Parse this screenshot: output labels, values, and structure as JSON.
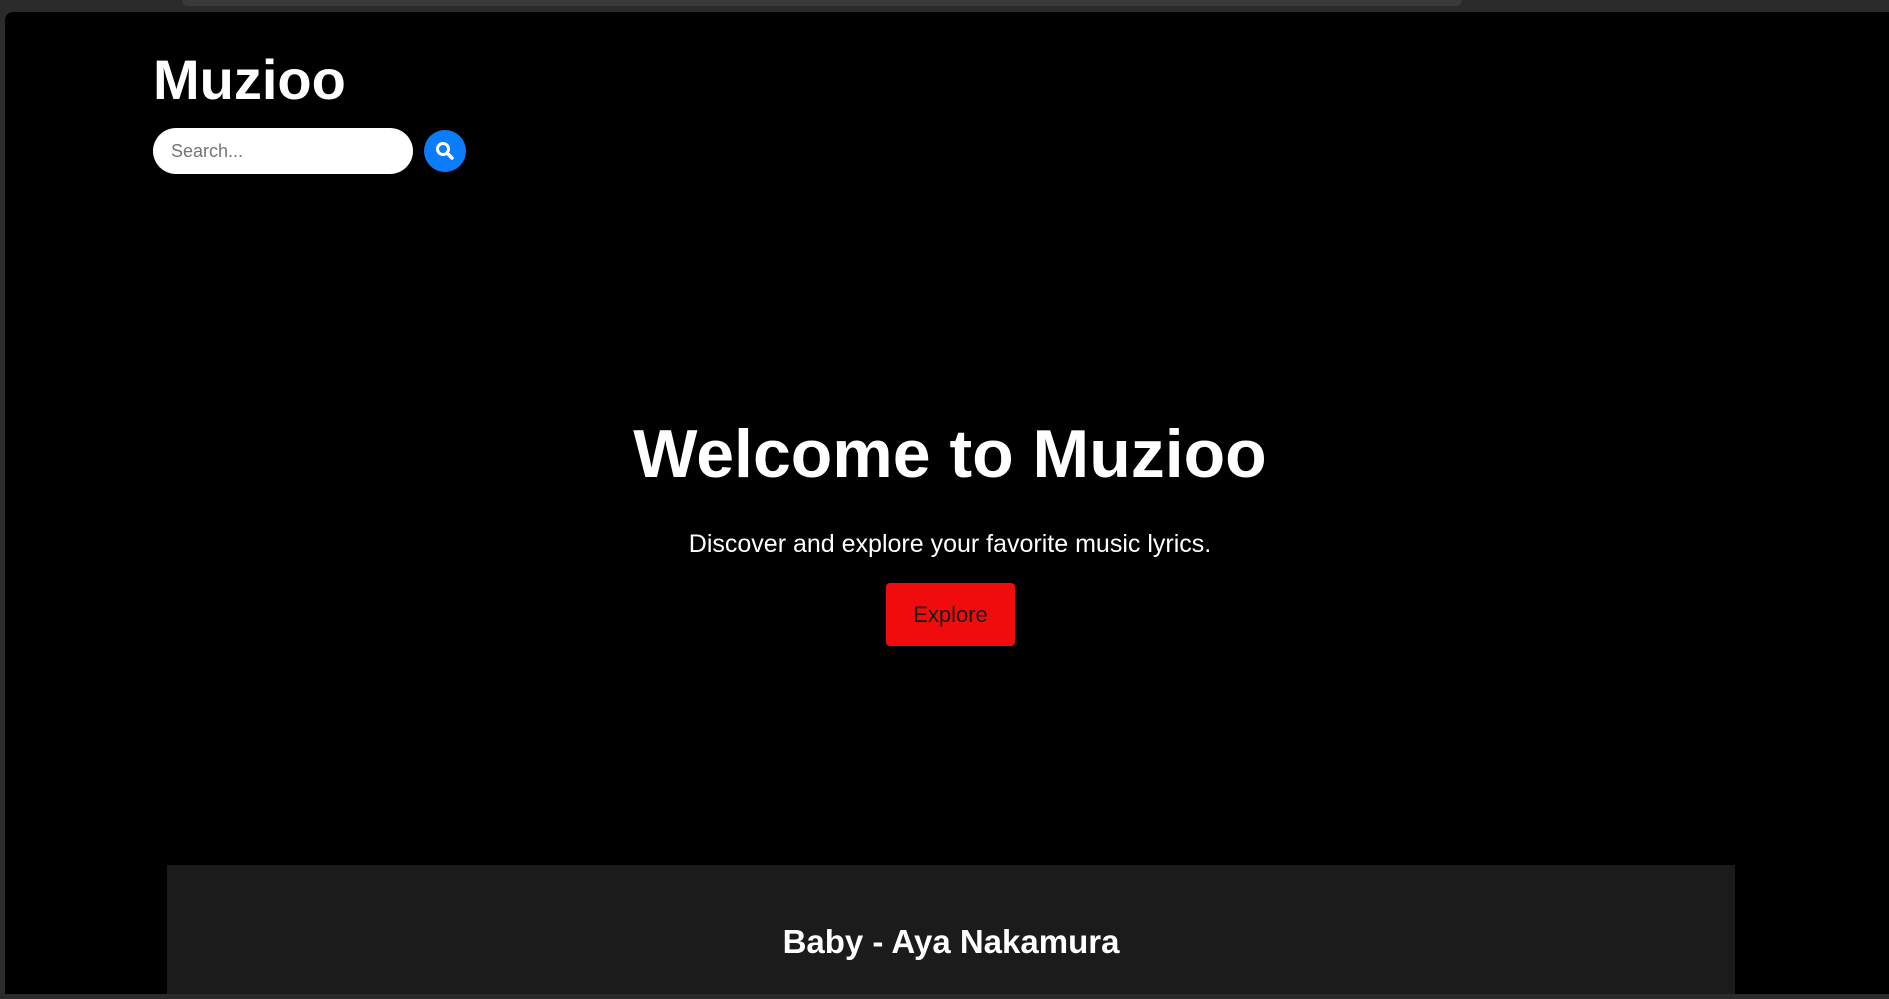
{
  "header": {
    "site_title": "Muzioo",
    "search_placeholder": "Search...",
    "search_value": ""
  },
  "hero": {
    "title": "Welcome to Muzioo",
    "subtitle": "Discover and explore your favorite music lyrics.",
    "explore_label": "Explore"
  },
  "featured": {
    "song_title": "Baby - Aya Nakamura"
  },
  "icons": {
    "search": "search-icon"
  },
  "colors": {
    "background": "#000000",
    "search_button": "#0b7dfa",
    "explore_button": "#f00c0c",
    "card_background": "#1b1b1b"
  }
}
